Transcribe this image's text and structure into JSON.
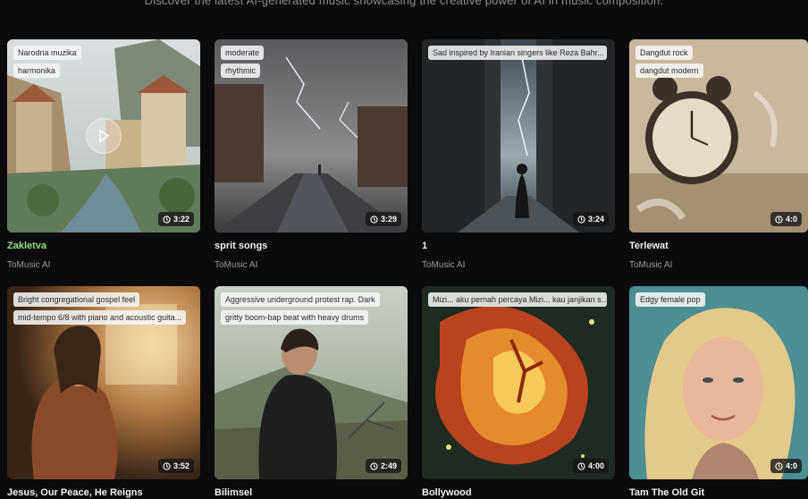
{
  "header": {
    "subtitle": "Discover the latest AI-generated music showcasing the creative power of AI in music composition."
  },
  "tracks": [
    {
      "title": "Zakletva",
      "artist": "ToMusic AI",
      "duration": "3:22",
      "tags": [
        "Narodna muzika",
        "harmonika"
      ],
      "active": true
    },
    {
      "title": "sprit songs",
      "artist": "ToMusic AI",
      "duration": "3:29",
      "tags": [
        "moderate",
        "rhythmic"
      ]
    },
    {
      "title": "1",
      "artist": "ToMusic AI",
      "duration": "3:24",
      "tags": [
        "Sad inspired by Iranian singers like Reza Bahr..."
      ]
    },
    {
      "title": "Terlewat",
      "artist": "ToMusic AI",
      "duration": "4:0",
      "tags": [
        "Dangdut rock",
        "dangdut modern"
      ]
    },
    {
      "title": "Jesus, Our Peace, He Reigns",
      "duration": "3:52",
      "tags": [
        "Bright congregational gospel feel",
        "mid-tempo 6/8 with piano and acoustic guita..."
      ]
    },
    {
      "title": "Bilimsel",
      "duration": "2:49",
      "tags": [
        "Aggressive underground protest rap. Dark",
        "gritty boom-bap beat with heavy drums"
      ]
    },
    {
      "title": "Bollywood",
      "duration": "4:00",
      "tags": [
        "Mizi... aku pernah percaya Mizi... kau janjikan s..."
      ]
    },
    {
      "title": "Tam The Old Git",
      "duration": "4:0",
      "tags": [
        "Edgy female pop"
      ]
    }
  ],
  "icons": {
    "play": "play-icon",
    "clock": "clock-icon"
  },
  "colors": {
    "background": "#0b0b0d",
    "active_title": "#8ee37c"
  }
}
